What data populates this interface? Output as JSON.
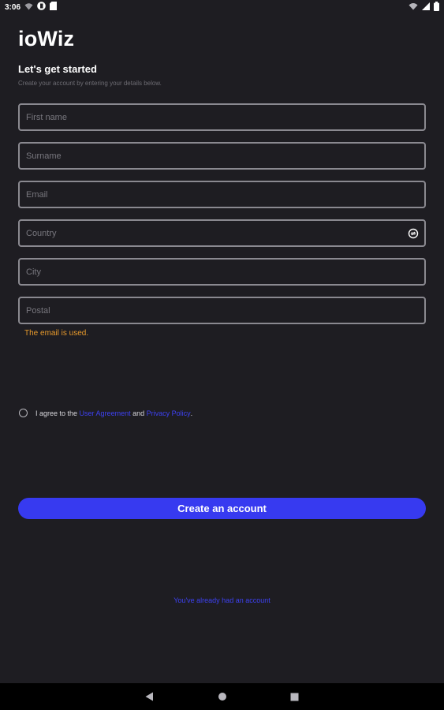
{
  "status_bar": {
    "time": "3:06"
  },
  "app": {
    "title": "ioWiz",
    "headline": "Let's get started",
    "subtitle": "Create your account by entering your details below."
  },
  "form": {
    "first_name": {
      "placeholder": "First name",
      "value": ""
    },
    "surname": {
      "placeholder": "Surname",
      "value": ""
    },
    "email": {
      "placeholder": "Email",
      "value": ""
    },
    "country": {
      "placeholder": "Country",
      "value": ""
    },
    "city": {
      "placeholder": "City",
      "value": ""
    },
    "postal": {
      "placeholder": "Postal",
      "value": ""
    },
    "error": "The email is used."
  },
  "agreement": {
    "prefix": "I agree to the ",
    "user_agreement": "User Agreement",
    "conjunction": " and ",
    "privacy_policy": "Privacy Policy",
    "suffix": "."
  },
  "actions": {
    "create_account": "Create an account",
    "already_have_account": "You've already had an account"
  },
  "colors": {
    "background": "#1e1d22",
    "accent": "#373af0",
    "error": "#e89a2c",
    "field_border": "#8a8990"
  },
  "icons": {
    "country_field": "country-picker-icon",
    "nav_back": "back-triangle-icon",
    "nav_home": "home-circle-icon",
    "nav_recents": "recents-square-icon"
  }
}
